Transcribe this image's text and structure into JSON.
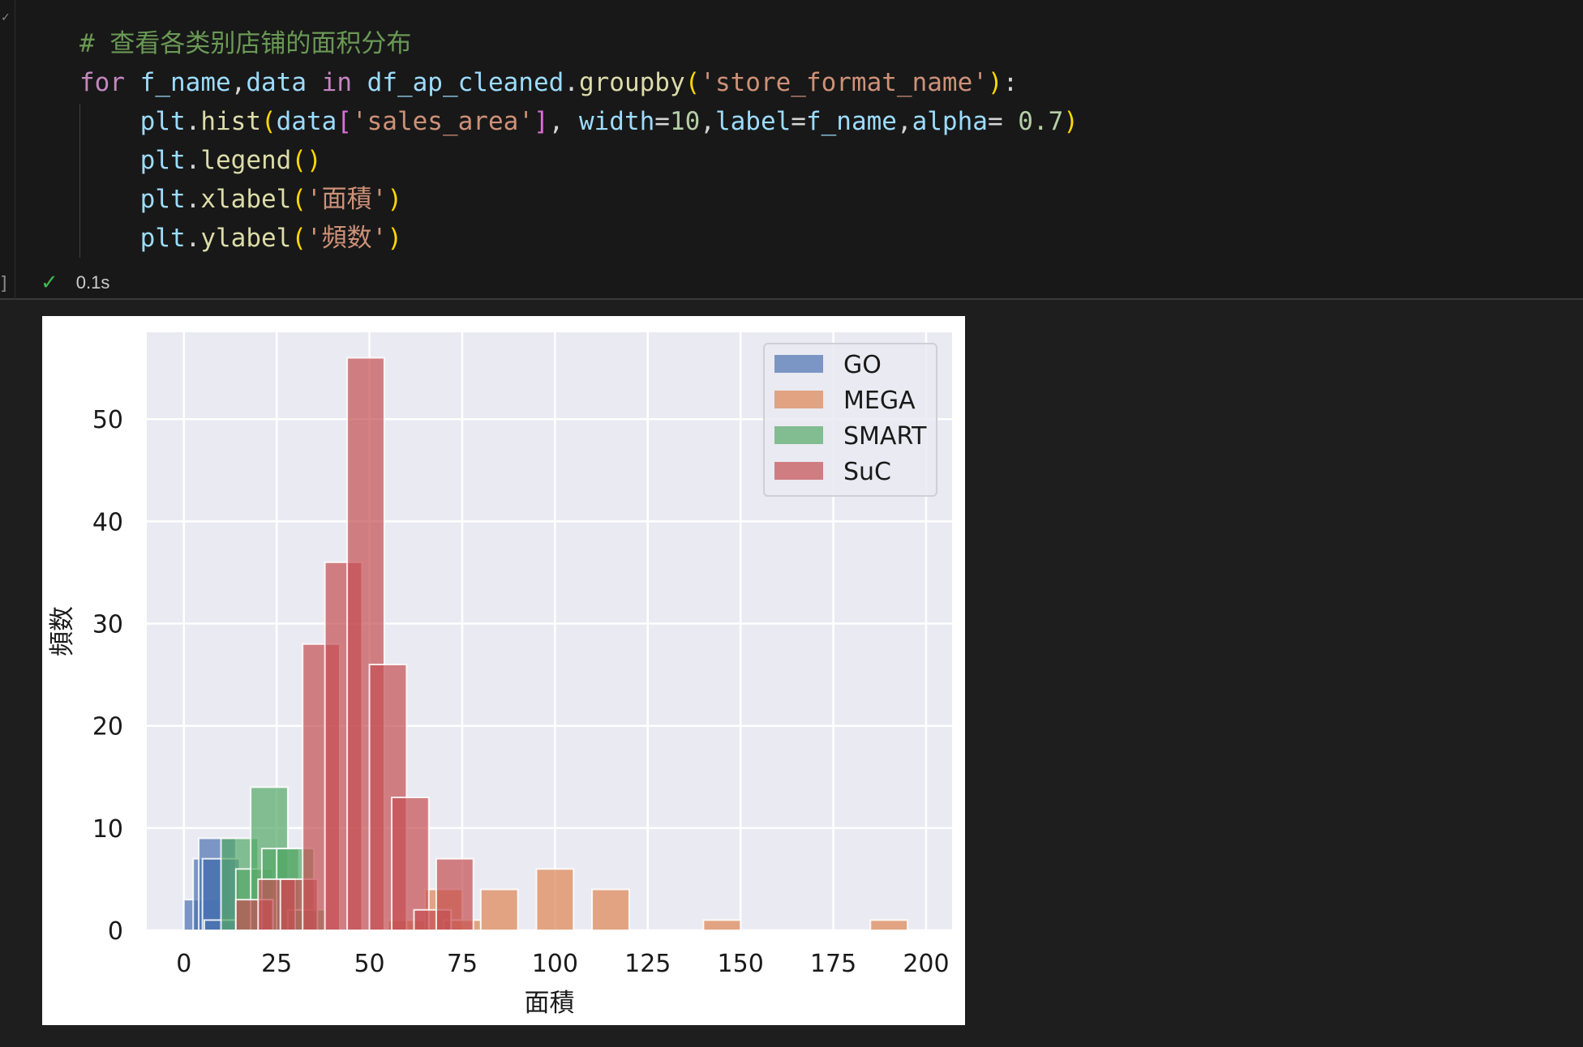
{
  "cell": {
    "code_lines": [
      [
        {
          "t": "# 查看各类别店铺的面积分布",
          "c": "comment"
        }
      ],
      [
        {
          "t": "for",
          "c": "kw"
        },
        {
          "t": " ",
          "c": "plain"
        },
        {
          "t": "f_name",
          "c": "var"
        },
        {
          "t": ",",
          "c": "plain"
        },
        {
          "t": "data",
          "c": "var"
        },
        {
          "t": " ",
          "c": "plain"
        },
        {
          "t": "in",
          "c": "kw"
        },
        {
          "t": " ",
          "c": "plain"
        },
        {
          "t": "df_ap_cleaned",
          "c": "var"
        },
        {
          "t": ".",
          "c": "plain"
        },
        {
          "t": "groupby",
          "c": "fn"
        },
        {
          "t": "(",
          "c": "b1"
        },
        {
          "t": "'store_format_name'",
          "c": "str"
        },
        {
          "t": ")",
          "c": "b1"
        },
        {
          "t": ":",
          "c": "plain"
        }
      ],
      [
        {
          "t": "    ",
          "c": "plain"
        },
        {
          "t": "plt",
          "c": "var"
        },
        {
          "t": ".",
          "c": "plain"
        },
        {
          "t": "hist",
          "c": "fn"
        },
        {
          "t": "(",
          "c": "b1"
        },
        {
          "t": "data",
          "c": "var"
        },
        {
          "t": "[",
          "c": "b2"
        },
        {
          "t": "'sales_area'",
          "c": "str"
        },
        {
          "t": "]",
          "c": "b2"
        },
        {
          "t": ", ",
          "c": "plain"
        },
        {
          "t": "width",
          "c": "var"
        },
        {
          "t": "=",
          "c": "plain"
        },
        {
          "t": "10",
          "c": "num"
        },
        {
          "t": ",",
          "c": "plain"
        },
        {
          "t": "label",
          "c": "var"
        },
        {
          "t": "=",
          "c": "plain"
        },
        {
          "t": "f_name",
          "c": "var"
        },
        {
          "t": ",",
          "c": "plain"
        },
        {
          "t": "alpha",
          "c": "var"
        },
        {
          "t": "= ",
          "c": "plain"
        },
        {
          "t": "0.7",
          "c": "num"
        },
        {
          "t": ")",
          "c": "b1"
        }
      ],
      [
        {
          "t": "    ",
          "c": "plain"
        },
        {
          "t": "plt",
          "c": "var"
        },
        {
          "t": ".",
          "c": "plain"
        },
        {
          "t": "legend",
          "c": "fn"
        },
        {
          "t": "()",
          "c": "b1"
        }
      ],
      [
        {
          "t": "    ",
          "c": "plain"
        },
        {
          "t": "plt",
          "c": "var"
        },
        {
          "t": ".",
          "c": "plain"
        },
        {
          "t": "xlabel",
          "c": "fn"
        },
        {
          "t": "(",
          "c": "b1"
        },
        {
          "t": "'面積'",
          "c": "str"
        },
        {
          "t": ")",
          "c": "b1"
        }
      ],
      [
        {
          "t": "    ",
          "c": "plain"
        },
        {
          "t": "plt",
          "c": "var"
        },
        {
          "t": ".",
          "c": "plain"
        },
        {
          "t": "ylabel",
          "c": "fn"
        },
        {
          "t": "(",
          "c": "b1"
        },
        {
          "t": "'頻数'",
          "c": "str"
        },
        {
          "t": ")",
          "c": "b1"
        }
      ]
    ],
    "status": {
      "check_icon": "✓",
      "time": "0.1s"
    },
    "gutter_mark": "✓",
    "bracket": "]"
  },
  "chart_data": {
    "type": "bar",
    "subtype": "overlapping-histogram",
    "title": "",
    "xlabel": "面積",
    "ylabel": "頻数",
    "xlim": [
      -10,
      207
    ],
    "ylim": [
      0,
      58.5
    ],
    "xticks": [
      0,
      25,
      50,
      75,
      100,
      125,
      150,
      175,
      200
    ],
    "yticks": [
      0,
      10,
      20,
      30,
      40,
      50
    ],
    "grid": true,
    "legend_position": "top-right",
    "bar_width": 10,
    "alpha": 0.7,
    "series": [
      {
        "name": "GO",
        "color": "#4c72b0",
        "bins": [
          [
            0,
            3
          ],
          [
            2.5,
            7
          ],
          [
            4,
            9
          ],
          [
            5,
            7
          ],
          [
            5.5,
            1
          ]
        ]
      },
      {
        "name": "MEGA",
        "color": "#dd8452",
        "bins": [
          [
            55,
            1
          ],
          [
            65,
            4
          ],
          [
            70,
            1
          ],
          [
            80,
            4
          ],
          [
            95,
            6
          ],
          [
            110,
            4
          ],
          [
            140,
            1
          ],
          [
            185,
            1
          ]
        ]
      },
      {
        "name": "SMART",
        "color": "#55a868",
        "bins": [
          [
            10,
            9
          ],
          [
            14,
            6
          ],
          [
            18,
            14
          ],
          [
            21,
            8
          ],
          [
            25,
            8
          ],
          [
            28,
            2
          ]
        ]
      },
      {
        "name": "SuC",
        "color": "#c44e52",
        "bins": [
          [
            14,
            3
          ],
          [
            20,
            5
          ],
          [
            26,
            5
          ],
          [
            32,
            28
          ],
          [
            38,
            36
          ],
          [
            44,
            56
          ],
          [
            50,
            26
          ],
          [
            56,
            13
          ],
          [
            62,
            2
          ],
          [
            68,
            7
          ]
        ]
      }
    ]
  }
}
